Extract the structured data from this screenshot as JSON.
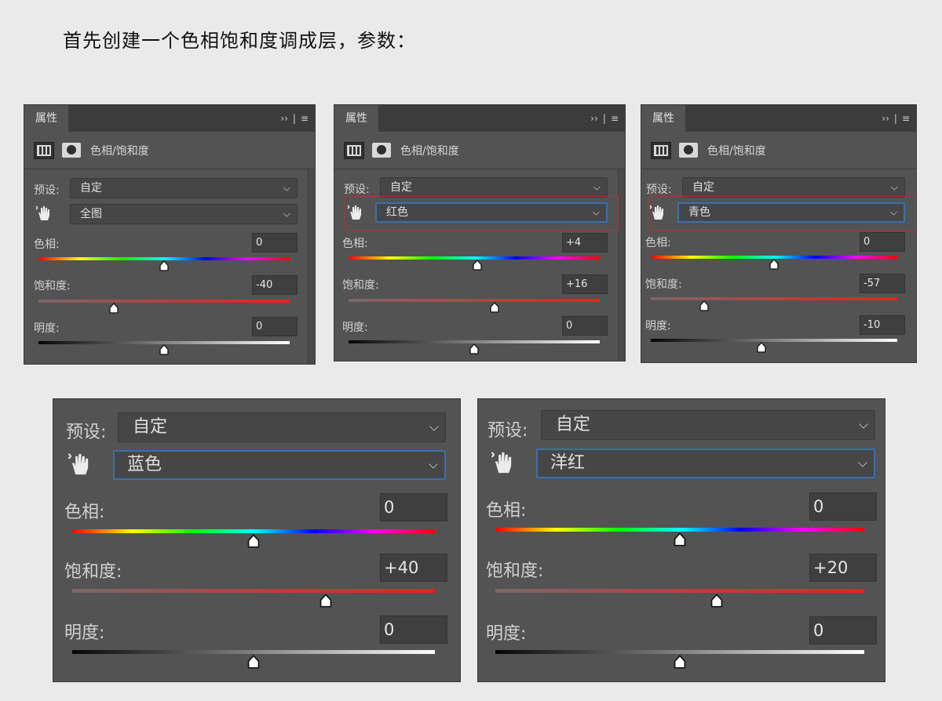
{
  "instruction": "首先创建一个色相饱和度调成层，参数：",
  "ui_colors": {
    "panel_bg": "#535353",
    "header_bg": "#3c3c3c",
    "focus_blue": "#3b6fb0",
    "highlight_red": "#a23a3a"
  },
  "icons": [
    "adjustment-layer-icon",
    "mask-icon",
    "targeted-adjustment-hand-icon",
    "chevron-down-icon",
    "collapse-panel-icon",
    "panel-menu-icon"
  ],
  "panels": [
    {
      "tab": "属性",
      "collapse": "››",
      "sep": "|",
      "menu": "≡",
      "type_title": "色相/饱和度",
      "preset_label": "预设:",
      "preset_value": "自定",
      "channel": "全图",
      "hue_label": "色相:",
      "hue_value": "0",
      "hue": 0,
      "sat_label": "饱和度:",
      "sat_value": "-40",
      "sat": -40,
      "light_label": "明度:",
      "light_value": "0",
      "light": 0
    },
    {
      "tab": "属性",
      "collapse": "››",
      "sep": "|",
      "menu": "≡",
      "type_title": "色相/饱和度",
      "preset_label": "预设:",
      "preset_value": "自定",
      "channel": "红色",
      "hue_label": "色相:",
      "hue_value": "+4",
      "hue": 4,
      "sat_label": "饱和度:",
      "sat_value": "+16",
      "sat": 16,
      "light_label": "明度:",
      "light_value": "0",
      "light": 0
    },
    {
      "tab": "属性",
      "collapse": "››",
      "sep": "|",
      "menu": "≡",
      "type_title": "色相/饱和度",
      "preset_label": "预设:",
      "preset_value": "自定",
      "channel": "青色",
      "hue_label": "色相:",
      "hue_value": "0",
      "hue": 0,
      "sat_label": "饱和度:",
      "sat_value": "-57",
      "sat": -57,
      "light_label": "明度:",
      "light_value": "-10",
      "light": -10
    },
    {
      "preset_label": "预设:",
      "preset_value": "自定",
      "channel": "蓝色",
      "hue_label": "色相:",
      "hue_value": "0",
      "hue": 0,
      "sat_label": "饱和度:",
      "sat_value": "+40",
      "sat": 40,
      "light_label": "明度:",
      "light_value": "0",
      "light": 0
    },
    {
      "preset_label": "预设:",
      "preset_value": "自定",
      "channel": "洋红",
      "hue_label": "色相:",
      "hue_value": "0",
      "hue": 0,
      "sat_label": "饱和度:",
      "sat_value": "+20",
      "sat": 20,
      "light_label": "明度:",
      "light_value": "0",
      "light": 0
    }
  ]
}
